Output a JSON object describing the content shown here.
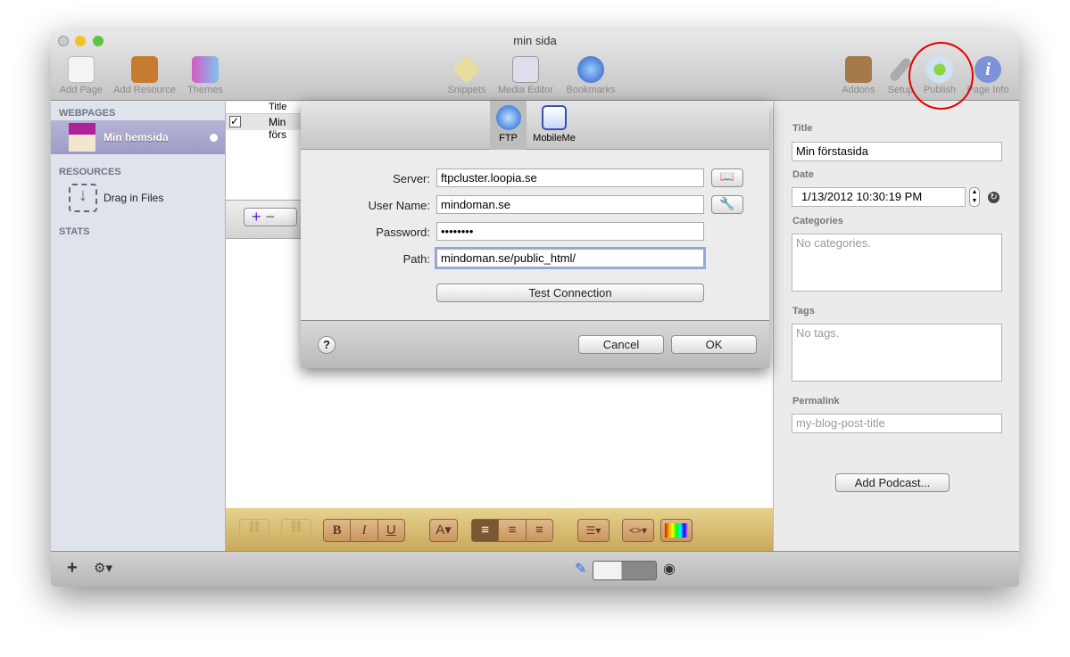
{
  "window": {
    "title": "min sida"
  },
  "toolbar": {
    "left": [
      "Add Page",
      "Add Resource",
      "Themes"
    ],
    "center": [
      "Snippets",
      "Media Editor",
      "Bookmarks"
    ],
    "right": [
      "Addons",
      "Setup",
      "Publish",
      "Page Info"
    ]
  },
  "sidebar": {
    "webpages_header": "WEBPAGES",
    "page": "Min hemsida",
    "resources_header": "RESOURCES",
    "drag": "Drag in Files",
    "stats_header": "STATS"
  },
  "list": {
    "column_title": "Title",
    "row_title": "Min förstasida",
    "row_visible": "Min förs"
  },
  "dialog": {
    "tabs": [
      "FTP",
      "MobileMe"
    ],
    "server_label": "Server:",
    "server": "ftpcluster.loopia.se",
    "user_label": "User Name:",
    "user": "mindoman.se",
    "password_label": "Password:",
    "password": "••••••••",
    "path_label": "Path:",
    "path": "mindoman.se/public_html/",
    "test": "Test Connection",
    "help": "?",
    "cancel": "Cancel",
    "ok": "OK"
  },
  "inspector": {
    "title_label": "Title",
    "title": "Min förstasida",
    "date_label": "Date",
    "date": "1/13/2012 10:30:19 PM",
    "categories_label": "Categories",
    "categories_placeholder": "No categories.",
    "tags_label": "Tags",
    "tags_placeholder": "No tags.",
    "permalink_label": "Permalink",
    "permalink_placeholder": "my-blog-post-title",
    "add_podcast": "Add Podcast..."
  },
  "format_bar": {
    "bold": "B",
    "italic": "I",
    "underline": "U",
    "font": "A▾",
    "list": "☰▾",
    "code": "<>▾"
  },
  "colors": {
    "highlight": "#e30000",
    "sidebar_selected": "#a7a6cc",
    "accent_plus": "#5a1fd6"
  }
}
